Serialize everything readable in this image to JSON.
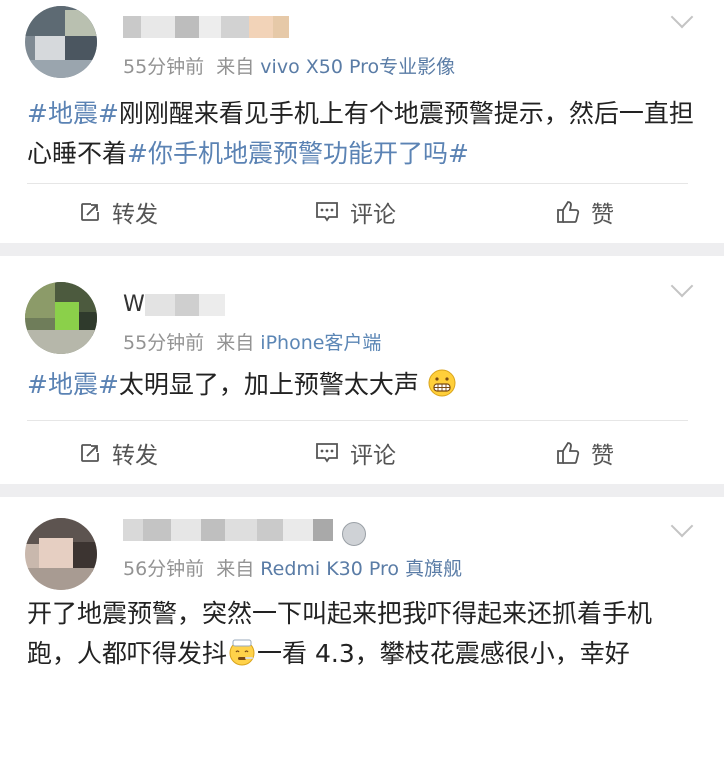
{
  "posts": [
    {
      "time": "55分钟前",
      "source_prefix": "来自",
      "source": "vivo X50 Pro专业影像",
      "content": [
        {
          "t": "#地震#",
          "topic": true
        },
        {
          "t": "刚刚醒来看见手机上有个地震预警提示，然后一直担心睡不着",
          "topic": false
        },
        {
          "t": "#你手机地震预警功能开了吗#",
          "topic": true
        }
      ],
      "actions": {
        "repost": "转发",
        "comment": "评论",
        "like": "赞"
      }
    },
    {
      "nick_visible": "W",
      "time": "55分钟前",
      "source_prefix": "来自",
      "source": "iPhone客户端",
      "content": [
        {
          "t": "#地震#",
          "topic": true
        },
        {
          "t": "太明显了，加上预警太大声",
          "topic": false
        }
      ],
      "actions": {
        "repost": "转发",
        "comment": "评论",
        "like": "赞"
      }
    },
    {
      "time": "56分钟前",
      "source_prefix": "来自",
      "source": "Redmi K30 Pro 真旗舰",
      "content": [
        {
          "t": "开了地震预警，突然一下叫起来把我吓得起来还抓着手机跑，人都吓得发抖",
          "topic": false
        },
        {
          "t": "一看 4.3，攀枝花震感很小，幸好",
          "topic": false
        }
      ],
      "actions": {}
    }
  ],
  "icons": [
    "repost-icon",
    "comment-icon",
    "like-icon",
    "chevron-down-icon",
    "grin-emoji",
    "sick-emoji"
  ],
  "colors": {
    "topic": "#5b83b4",
    "meta": "#939393",
    "source": "#5a7ca6",
    "separator": "#eeeef0"
  }
}
